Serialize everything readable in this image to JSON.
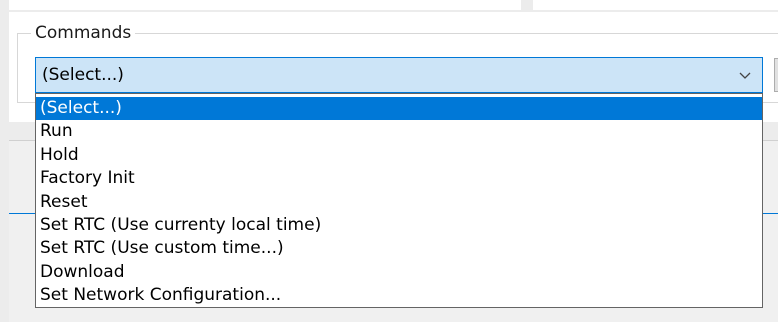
{
  "commands_group": {
    "legend": "Commands"
  },
  "combo": {
    "selected_value": "(Select...)",
    "arrow_icon": "chevron-down-icon"
  },
  "dropdown": {
    "highlighted_index": 0,
    "options": [
      "(Select...)",
      "Run",
      "Hold",
      "Factory Init",
      "Reset",
      "Set RTC (Use currenty local time)",
      "Set RTC (Use custom time...)",
      "Download",
      "Set Network Configuration..."
    ]
  },
  "colors": {
    "accent": "#0078d7",
    "combo_background": "#cce4f7",
    "window_background": "#f0f0f0"
  }
}
